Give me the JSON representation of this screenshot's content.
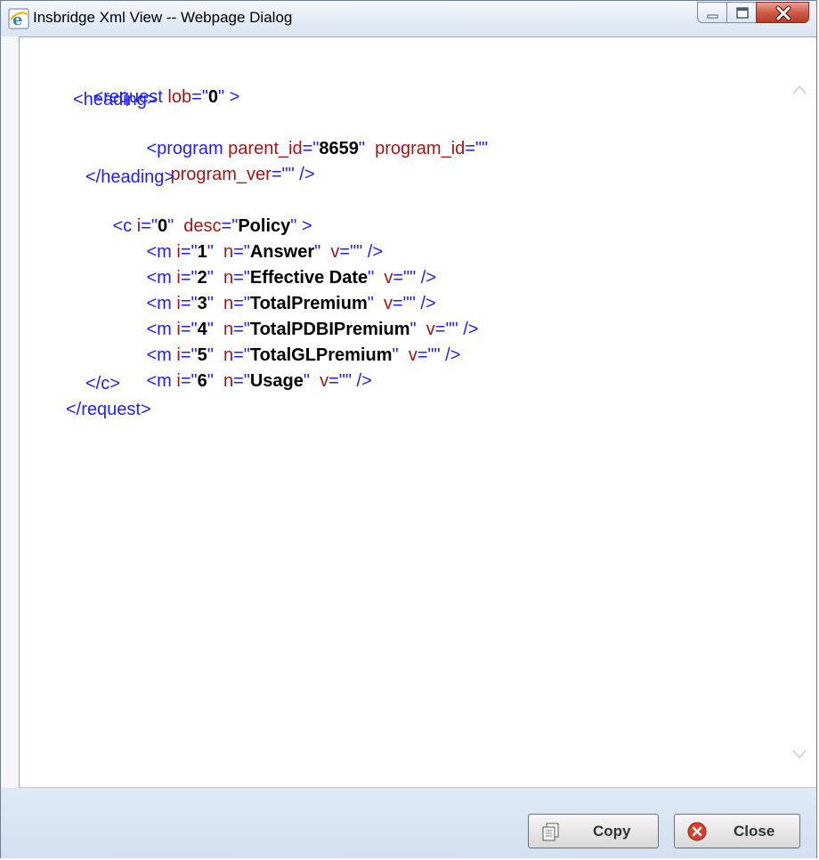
{
  "window": {
    "title": "Insbridge Xml View -- Webpage Dialog",
    "icon": "ie-icon",
    "controls": [
      "minimize",
      "maximize",
      "close"
    ]
  },
  "xml": {
    "request_open": {
      "tag": "<request ",
      "attr": "lob",
      "eq": "=\"",
      "val": "0",
      "close": "\"",
      "end": " >"
    },
    "heading_open": "<heading>",
    "program_line1": {
      "tag": "<program ",
      "a1": "parent_id",
      "v1": "8659",
      "a2": "program_id",
      "v2_text": "\"\""
    },
    "program_line2": {
      "a3": "program_ver",
      "v3_text": "\"\"",
      "end": " />"
    },
    "heading_close": "</heading>",
    "c_open": {
      "tag": "<c ",
      "a1": "i",
      "v1": "0",
      "a2": "desc",
      "v2": "Policy",
      "end": " >"
    },
    "m_items": [
      {
        "i": "1",
        "n": "Answer"
      },
      {
        "i": "2",
        "n": "Effective Date"
      },
      {
        "i": "3",
        "n": "TotalPremium"
      },
      {
        "i": "4",
        "n": "TotalPDBIPremium"
      },
      {
        "i": "5",
        "n": "TotalGLPremium"
      },
      {
        "i": "6",
        "n": "Usage"
      }
    ],
    "c_close": "</c>",
    "request_close": "</request>"
  },
  "buttons": {
    "copy": "Copy",
    "close": "Close"
  },
  "colors": {
    "tag": "#1f1ff2",
    "attr": "#a31515",
    "value": "#000000"
  }
}
